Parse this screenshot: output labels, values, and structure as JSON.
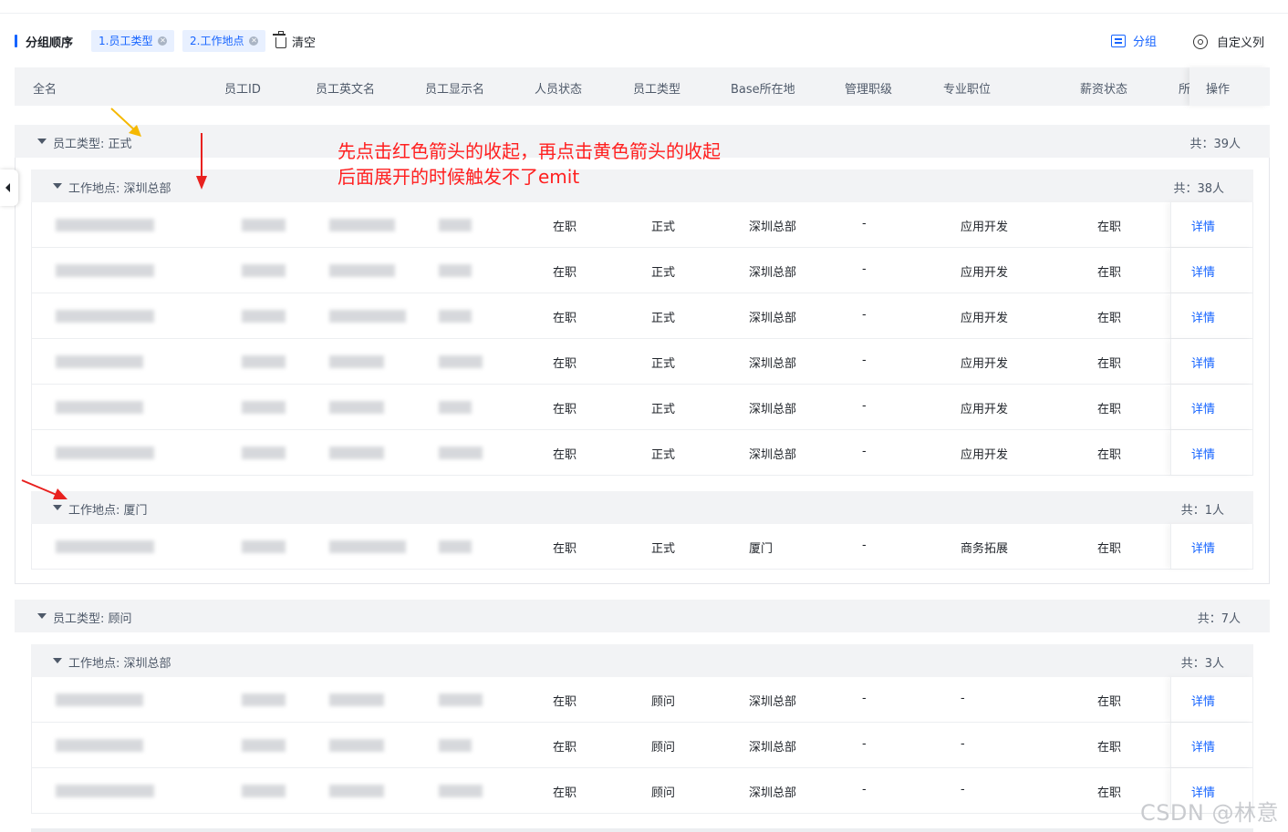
{
  "toolbar": {
    "title": "分组顺序",
    "chips": [
      {
        "label": "1.员工类型"
      },
      {
        "label": "2.工作地点"
      }
    ],
    "clear_label": "清空",
    "group_label": "分组",
    "custom_columns_label": "自定义列"
  },
  "columns": [
    "全名",
    "员工ID",
    "员工英文名",
    "员工显示名",
    "人员状态",
    "员工类型",
    "Base所在地",
    "管理职级",
    "专业职位",
    "薪资状态",
    "所"
  ],
  "operation_header": "操作",
  "detail_label": "详情",
  "groups": [
    {
      "title": "员工类型: 正式",
      "count": "共：39人",
      "subgroups": [
        {
          "title": "工作地点: 深圳总部",
          "count": "共：38人",
          "rows": [
            {
              "status": "在职",
              "type": "正式",
              "base": "深圳总部",
              "level": "-",
              "position": "应用开发",
              "salary": "在职"
            },
            {
              "status": "在职",
              "type": "正式",
              "base": "深圳总部",
              "level": "-",
              "position": "应用开发",
              "salary": "在职"
            },
            {
              "status": "在职",
              "type": "正式",
              "base": "深圳总部",
              "level": "-",
              "position": "应用开发",
              "salary": "在职"
            },
            {
              "status": "在职",
              "type": "正式",
              "base": "深圳总部",
              "level": "-",
              "position": "应用开发",
              "salary": "在职"
            },
            {
              "status": "在职",
              "type": "正式",
              "base": "深圳总部",
              "level": "-",
              "position": "应用开发",
              "salary": "在职"
            },
            {
              "status": "在职",
              "type": "正式",
              "base": "深圳总部",
              "level": "-",
              "position": "应用开发",
              "salary": "在职"
            }
          ]
        },
        {
          "title": "工作地点: 厦门",
          "count": "共：1人",
          "rows": [
            {
              "status": "在职",
              "type": "正式",
              "base": "厦门",
              "level": "-",
              "position": "商务拓展",
              "salary": "在职"
            }
          ]
        }
      ]
    },
    {
      "title": "员工类型: 顾问",
      "count": "共：7人",
      "subgroups": [
        {
          "title": "工作地点: 深圳总部",
          "count": "共：3人",
          "rows": [
            {
              "status": "在职",
              "type": "顾问",
              "base": "深圳总部",
              "level": "-",
              "position": "-",
              "salary": "在职"
            },
            {
              "status": "在职",
              "type": "顾问",
              "base": "深圳总部",
              "level": "-",
              "position": "-",
              "salary": "在职"
            },
            {
              "status": "在职",
              "type": "顾问",
              "base": "深圳总部",
              "level": "-",
              "position": "-",
              "salary": "在职"
            }
          ]
        }
      ]
    }
  ],
  "annotation": {
    "line1": "先点击红色箭头的收起，再点击黄色箭头的收起",
    "line2": "后面展开的时候触发不了emit",
    "arrow_colors": {
      "red": "#e8211f",
      "yellow": "#f5b800"
    }
  },
  "watermark": "CSDN @林意",
  "colors": {
    "accent": "#1664ff",
    "header_bg": "#f2f3f5",
    "annotation": "#ff1f1f"
  }
}
